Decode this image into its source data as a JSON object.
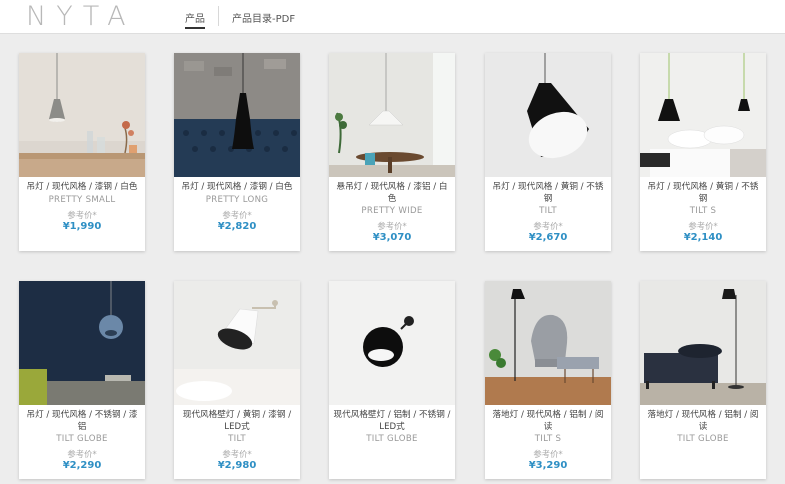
{
  "header": {
    "logo": "NYTA",
    "tabs": [
      {
        "label": "产品",
        "active": true
      },
      {
        "label": "产品目录-PDF",
        "active": false
      }
    ]
  },
  "ref_label": "参考价*",
  "price_color": "#2e8fc4",
  "products": [
    {
      "category": "吊灯 / 现代风格 / 漆钢 / 白色",
      "name": "PRETTY SMALL",
      "price": "¥1,990"
    },
    {
      "category": "吊灯 / 现代风格 / 漆钢 / 白色",
      "name": "PRETTY LONG",
      "price": "¥2,820"
    },
    {
      "category": "悬吊灯 / 现代风格 / 漆铝 / 白色",
      "name": "PRETTY WIDE",
      "price": "¥3,070"
    },
    {
      "category": "吊灯 / 现代风格 / 黄铜 / 不锈钢",
      "name": "TILT",
      "price": "¥2,670"
    },
    {
      "category": "吊灯 / 现代风格 / 黄铜 / 不锈钢",
      "name": "TILT S",
      "price": "¥2,140"
    },
    {
      "category": "吊灯 / 现代风格 / 不锈钢 / 漆铝",
      "name": "TILT GLOBE",
      "price": "¥2,290"
    },
    {
      "category": "现代风格壁灯 / 黄铜 / 漆钢 / LED式",
      "name": "TILT",
      "price": "¥2,980"
    },
    {
      "category": "现代风格壁灯 / 铝制 / 不锈钢 / LED式",
      "name": "TILT GLOBE",
      "price": ""
    },
    {
      "category": "落地灯 / 现代风格 / 铝制 / 阅读",
      "name": "TILT S",
      "price": "¥3,290"
    },
    {
      "category": "落地灯 / 现代风格 / 铝制 / 阅读",
      "name": "TILT GLOBE",
      "price": ""
    }
  ]
}
